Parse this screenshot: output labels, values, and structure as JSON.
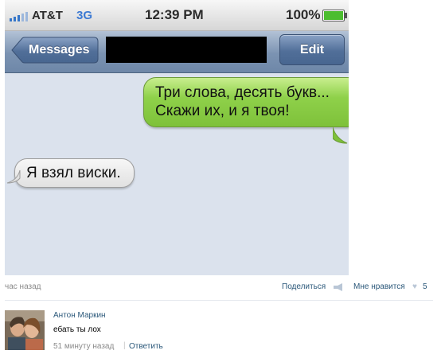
{
  "status_bar": {
    "carrier": "AT&T",
    "network": "3G",
    "time": "12:39 PM",
    "battery_percent": "100%"
  },
  "nav": {
    "back_label": "Messages",
    "edit_label": "Edit"
  },
  "messages": [
    {
      "direction": "outgoing",
      "text": "Три слова, десять букв... Скажи их, и я твоя!"
    },
    {
      "direction": "incoming",
      "text": "Я взял виски."
    }
  ],
  "post_footer": {
    "time_ago": "час назад",
    "share_label": "Поделиться",
    "like_label": "Мне нравится",
    "like_count": "5"
  },
  "comment": {
    "author": "Антон Маркин",
    "text": "ебать ты лох",
    "time_ago": "51 минуту назад",
    "separator": "|",
    "reply_label": "Ответить"
  },
  "colors": {
    "outgoing_bubble": "#8fd14a",
    "incoming_bubble": "#e6e6e6",
    "nav_bar": "#7b93b2",
    "chat_background": "#dbe2ed",
    "link": "#2b587a"
  },
  "icons": [
    "signal-icon",
    "battery-icon",
    "share-icon",
    "heart-icon"
  ]
}
